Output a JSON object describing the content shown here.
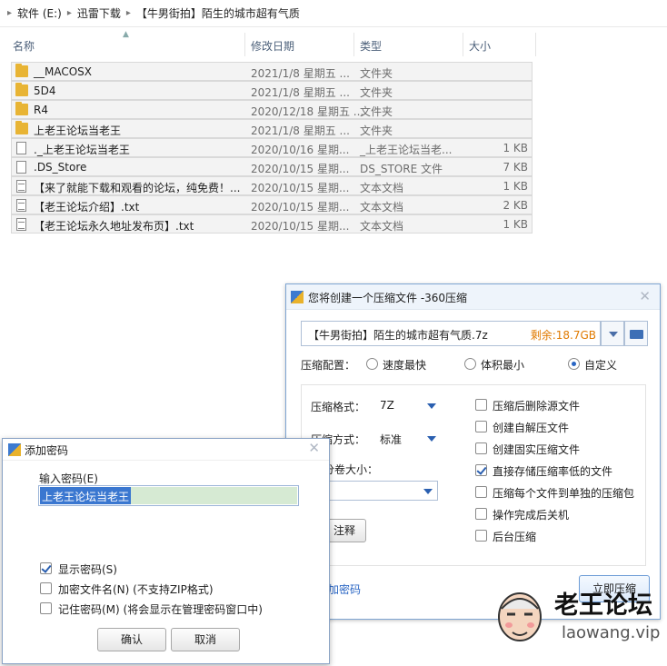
{
  "breadcrumb": [
    "软件 (E:)",
    "迅雷下载",
    "【牛男街拍】陌生的城市超有气质"
  ],
  "columns": {
    "name": "名称",
    "date": "修改日期",
    "type": "类型",
    "size": "大小"
  },
  "files": [
    {
      "icon": "folder-icon",
      "name": "__MACOSX",
      "date": "2021/1/8 星期五 ...",
      "type": "文件夹",
      "size": ""
    },
    {
      "icon": "folder-icon",
      "name": "5D4",
      "date": "2021/1/8 星期五 ...",
      "type": "文件夹",
      "size": ""
    },
    {
      "icon": "folder-icon",
      "name": "R4",
      "date": "2020/12/18 星期五 ...",
      "type": "文件夹",
      "size": ""
    },
    {
      "icon": "folder-icon",
      "name": "上老王论坛当老王",
      "date": "2021/1/8 星期五 ...",
      "type": "文件夹",
      "size": ""
    },
    {
      "icon": "file-icon",
      "name": "._上老王论坛当老王",
      "date": "2020/10/16 星期...",
      "type": "_上老王论坛当老...",
      "size": "1 KB"
    },
    {
      "icon": "file-icon",
      "name": ".DS_Store",
      "date": "2020/10/15 星期...",
      "type": "DS_STORE 文件",
      "size": "7 KB"
    },
    {
      "icon": "text-file-icon",
      "name": "【来了就能下载和观看的论坛，纯免费！...",
      "date": "2020/10/15 星期...",
      "type": "文本文档",
      "size": "1 KB"
    },
    {
      "icon": "text-file-icon",
      "name": "【老王论坛介绍】.txt",
      "date": "2020/10/15 星期...",
      "type": "文本文档",
      "size": "2 KB"
    },
    {
      "icon": "text-file-icon",
      "name": "【老王论坛永久地址发布页】.txt",
      "date": "2020/10/15 星期...",
      "type": "文本文档",
      "size": "1 KB"
    }
  ],
  "zip": {
    "title": "您将创建一个压缩文件 -360压缩",
    "filename": "【牛男街拍】陌生的城市超有气质.7z",
    "free": "剩余:18.7GB",
    "config_label": "压缩配置：",
    "radios": [
      {
        "label": "速度最快",
        "on": false
      },
      {
        "label": "体积最小",
        "on": false
      },
      {
        "label": "自定义",
        "on": true
      }
    ],
    "format_label": "压缩格式：",
    "format_value": "7Z",
    "method_label": "压缩方式：",
    "method_value": "标准",
    "split_label": "分卷大小：",
    "comment_btn": "注释",
    "add_pwd": "加密码",
    "checks": [
      {
        "label": "压缩后删除源文件",
        "on": false
      },
      {
        "label": "创建自解压文件",
        "on": false
      },
      {
        "label": "创建固实压缩文件",
        "on": false
      },
      {
        "label": "直接存储压缩率低的文件",
        "on": true
      },
      {
        "label": "压缩每个文件到单独的压缩包",
        "on": false
      },
      {
        "label": "操作完成后关机",
        "on": false
      },
      {
        "label": "后台压缩",
        "on": false
      }
    ],
    "start_btn": "立即压缩"
  },
  "pwd": {
    "title": "添加密码",
    "input_label": "输入密码(E)",
    "value": "上老王论坛当老王",
    "checks": [
      {
        "label": "显示密码(S)",
        "on": true
      },
      {
        "label": "加密文件名(N) (不支持ZIP格式)",
        "on": false
      },
      {
        "label": "记住密码(M) (将会显示在管理密码窗口中)",
        "on": false
      }
    ],
    "ok": "确认",
    "cancel": "取消"
  },
  "watermark": {
    "brand": "老王论坛",
    "url": "laowang.vip"
  },
  "colors": {
    "accent": "#2a66c4",
    "free_space": "#e07a00",
    "selection": "#d6ead3"
  }
}
